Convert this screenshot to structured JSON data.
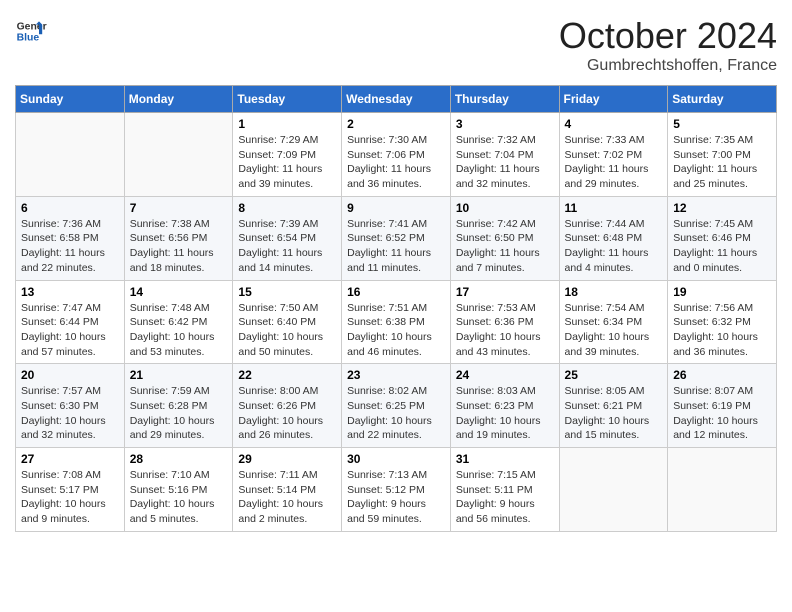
{
  "logo": {
    "general": "General",
    "blue": "Blue"
  },
  "header": {
    "month": "October 2024",
    "location": "Gumbrechtshoffen, France"
  },
  "weekdays": [
    "Sunday",
    "Monday",
    "Tuesday",
    "Wednesday",
    "Thursday",
    "Friday",
    "Saturday"
  ],
  "weeks": [
    [
      {
        "day": "",
        "info": ""
      },
      {
        "day": "",
        "info": ""
      },
      {
        "day": "1",
        "info": "Sunrise: 7:29 AM\nSunset: 7:09 PM\nDaylight: 11 hours\nand 39 minutes."
      },
      {
        "day": "2",
        "info": "Sunrise: 7:30 AM\nSunset: 7:06 PM\nDaylight: 11 hours\nand 36 minutes."
      },
      {
        "day": "3",
        "info": "Sunrise: 7:32 AM\nSunset: 7:04 PM\nDaylight: 11 hours\nand 32 minutes."
      },
      {
        "day": "4",
        "info": "Sunrise: 7:33 AM\nSunset: 7:02 PM\nDaylight: 11 hours\nand 29 minutes."
      },
      {
        "day": "5",
        "info": "Sunrise: 7:35 AM\nSunset: 7:00 PM\nDaylight: 11 hours\nand 25 minutes."
      }
    ],
    [
      {
        "day": "6",
        "info": "Sunrise: 7:36 AM\nSunset: 6:58 PM\nDaylight: 11 hours\nand 22 minutes."
      },
      {
        "day": "7",
        "info": "Sunrise: 7:38 AM\nSunset: 6:56 PM\nDaylight: 11 hours\nand 18 minutes."
      },
      {
        "day": "8",
        "info": "Sunrise: 7:39 AM\nSunset: 6:54 PM\nDaylight: 11 hours\nand 14 minutes."
      },
      {
        "day": "9",
        "info": "Sunrise: 7:41 AM\nSunset: 6:52 PM\nDaylight: 11 hours\nand 11 minutes."
      },
      {
        "day": "10",
        "info": "Sunrise: 7:42 AM\nSunset: 6:50 PM\nDaylight: 11 hours\nand 7 minutes."
      },
      {
        "day": "11",
        "info": "Sunrise: 7:44 AM\nSunset: 6:48 PM\nDaylight: 11 hours\nand 4 minutes."
      },
      {
        "day": "12",
        "info": "Sunrise: 7:45 AM\nSunset: 6:46 PM\nDaylight: 11 hours\nand 0 minutes."
      }
    ],
    [
      {
        "day": "13",
        "info": "Sunrise: 7:47 AM\nSunset: 6:44 PM\nDaylight: 10 hours\nand 57 minutes."
      },
      {
        "day": "14",
        "info": "Sunrise: 7:48 AM\nSunset: 6:42 PM\nDaylight: 10 hours\nand 53 minutes."
      },
      {
        "day": "15",
        "info": "Sunrise: 7:50 AM\nSunset: 6:40 PM\nDaylight: 10 hours\nand 50 minutes."
      },
      {
        "day": "16",
        "info": "Sunrise: 7:51 AM\nSunset: 6:38 PM\nDaylight: 10 hours\nand 46 minutes."
      },
      {
        "day": "17",
        "info": "Sunrise: 7:53 AM\nSunset: 6:36 PM\nDaylight: 10 hours\nand 43 minutes."
      },
      {
        "day": "18",
        "info": "Sunrise: 7:54 AM\nSunset: 6:34 PM\nDaylight: 10 hours\nand 39 minutes."
      },
      {
        "day": "19",
        "info": "Sunrise: 7:56 AM\nSunset: 6:32 PM\nDaylight: 10 hours\nand 36 minutes."
      }
    ],
    [
      {
        "day": "20",
        "info": "Sunrise: 7:57 AM\nSunset: 6:30 PM\nDaylight: 10 hours\nand 32 minutes."
      },
      {
        "day": "21",
        "info": "Sunrise: 7:59 AM\nSunset: 6:28 PM\nDaylight: 10 hours\nand 29 minutes."
      },
      {
        "day": "22",
        "info": "Sunrise: 8:00 AM\nSunset: 6:26 PM\nDaylight: 10 hours\nand 26 minutes."
      },
      {
        "day": "23",
        "info": "Sunrise: 8:02 AM\nSunset: 6:25 PM\nDaylight: 10 hours\nand 22 minutes."
      },
      {
        "day": "24",
        "info": "Sunrise: 8:03 AM\nSunset: 6:23 PM\nDaylight: 10 hours\nand 19 minutes."
      },
      {
        "day": "25",
        "info": "Sunrise: 8:05 AM\nSunset: 6:21 PM\nDaylight: 10 hours\nand 15 minutes."
      },
      {
        "day": "26",
        "info": "Sunrise: 8:07 AM\nSunset: 6:19 PM\nDaylight: 10 hours\nand 12 minutes."
      }
    ],
    [
      {
        "day": "27",
        "info": "Sunrise: 7:08 AM\nSunset: 5:17 PM\nDaylight: 10 hours\nand 9 minutes."
      },
      {
        "day": "28",
        "info": "Sunrise: 7:10 AM\nSunset: 5:16 PM\nDaylight: 10 hours\nand 5 minutes."
      },
      {
        "day": "29",
        "info": "Sunrise: 7:11 AM\nSunset: 5:14 PM\nDaylight: 10 hours\nand 2 minutes."
      },
      {
        "day": "30",
        "info": "Sunrise: 7:13 AM\nSunset: 5:12 PM\nDaylight: 9 hours\nand 59 minutes."
      },
      {
        "day": "31",
        "info": "Sunrise: 7:15 AM\nSunset: 5:11 PM\nDaylight: 9 hours\nand 56 minutes."
      },
      {
        "day": "",
        "info": ""
      },
      {
        "day": "",
        "info": ""
      }
    ]
  ]
}
